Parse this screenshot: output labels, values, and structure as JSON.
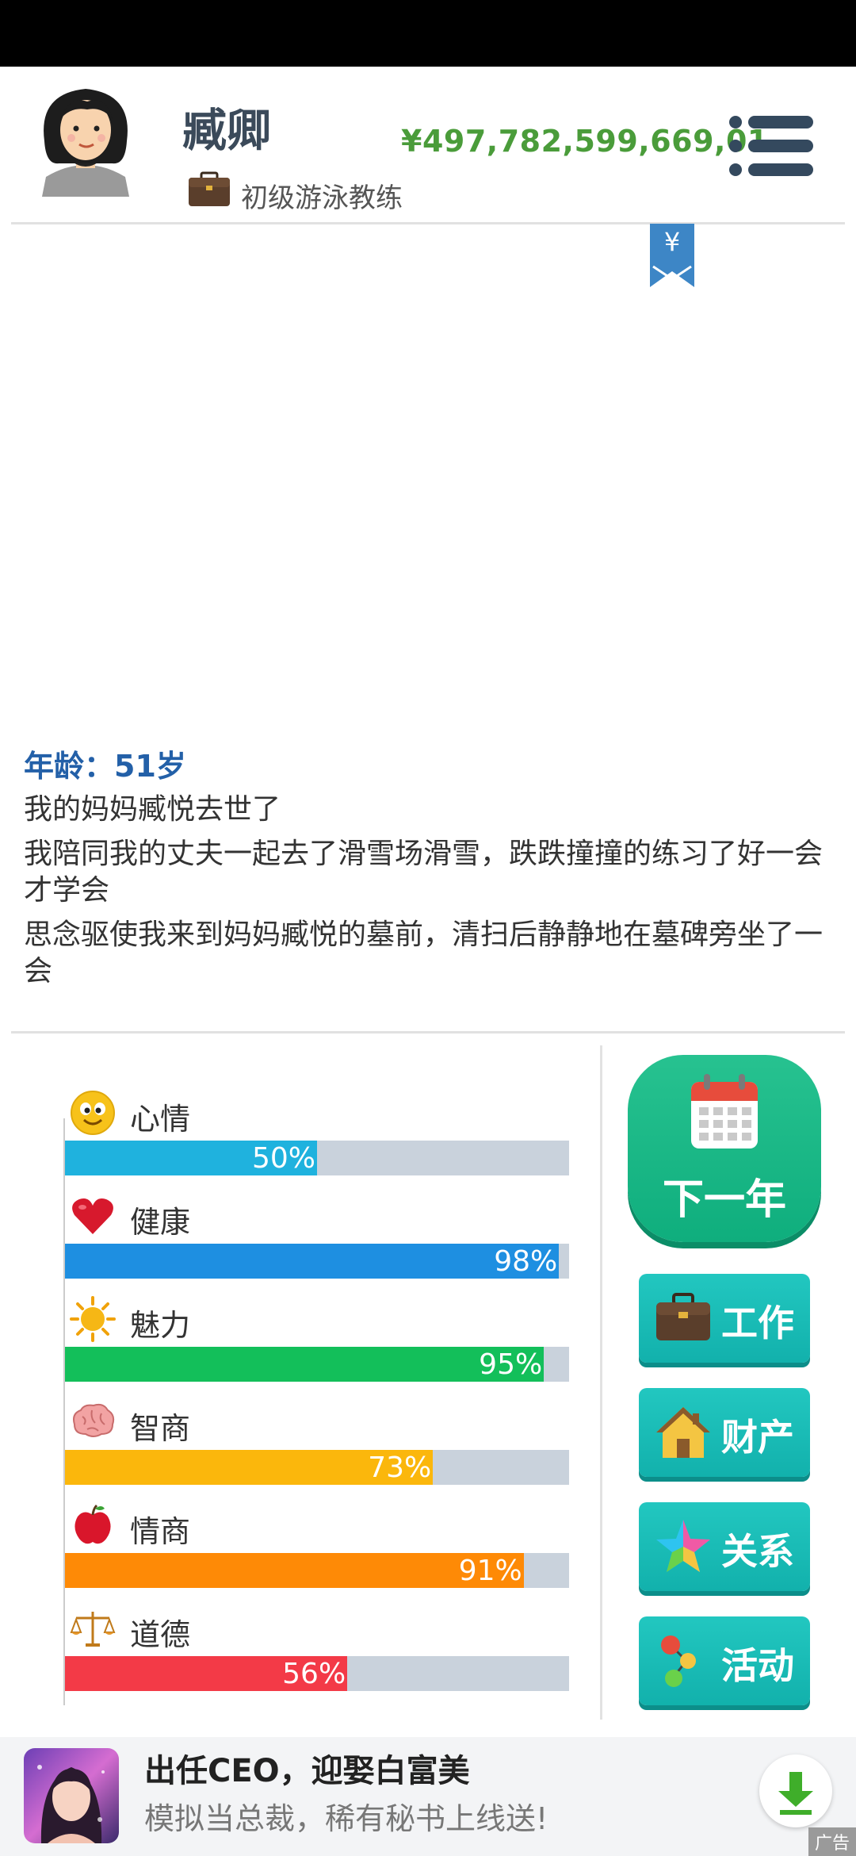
{
  "header": {
    "name": "臧卿",
    "job_title": "初级游泳教练",
    "money": "¥497,782,599,669,01"
  },
  "bookmark": {
    "symbol": "¥"
  },
  "story": {
    "age": "年龄：51岁",
    "events": [
      "我的妈妈臧悦去世了",
      "我陪同我的丈夫一起去了滑雪场滑雪，跌跌撞撞的练习了好一会才学会",
      "思念驱使我来到妈妈臧悦的墓前，清扫后静静地在墓碑旁坐了一会"
    ]
  },
  "stats": [
    {
      "label": "心情",
      "value": "50%",
      "fraction": 0.5,
      "color": "#1fb2de",
      "icon": "smiley-icon"
    },
    {
      "label": "健康",
      "value": "98%",
      "fraction": 0.98,
      "color": "#1e8fe1",
      "icon": "heart-icon"
    },
    {
      "label": "魅力",
      "value": "95%",
      "fraction": 0.95,
      "color": "#13bf5a",
      "icon": "sun-icon"
    },
    {
      "label": "智商",
      "value": "73%",
      "fraction": 0.73,
      "color": "#fbb70c",
      "icon": "brain-icon"
    },
    {
      "label": "情商",
      "value": "91%",
      "fraction": 0.91,
      "color": "#fe8a06",
      "icon": "apple-icon"
    },
    {
      "label": "道德",
      "value": "56%",
      "fraction": 0.56,
      "color": "#f33a47",
      "icon": "scales-icon"
    }
  ],
  "buttons": {
    "next_year": "下一年",
    "work": "工作",
    "property": "财产",
    "relations": "关系",
    "activities": "活动"
  },
  "ad": {
    "title": "出任CEO，迎娶白富美",
    "desc": "模拟当总裁，稀有秘书上线送!",
    "tag": "广告"
  }
}
